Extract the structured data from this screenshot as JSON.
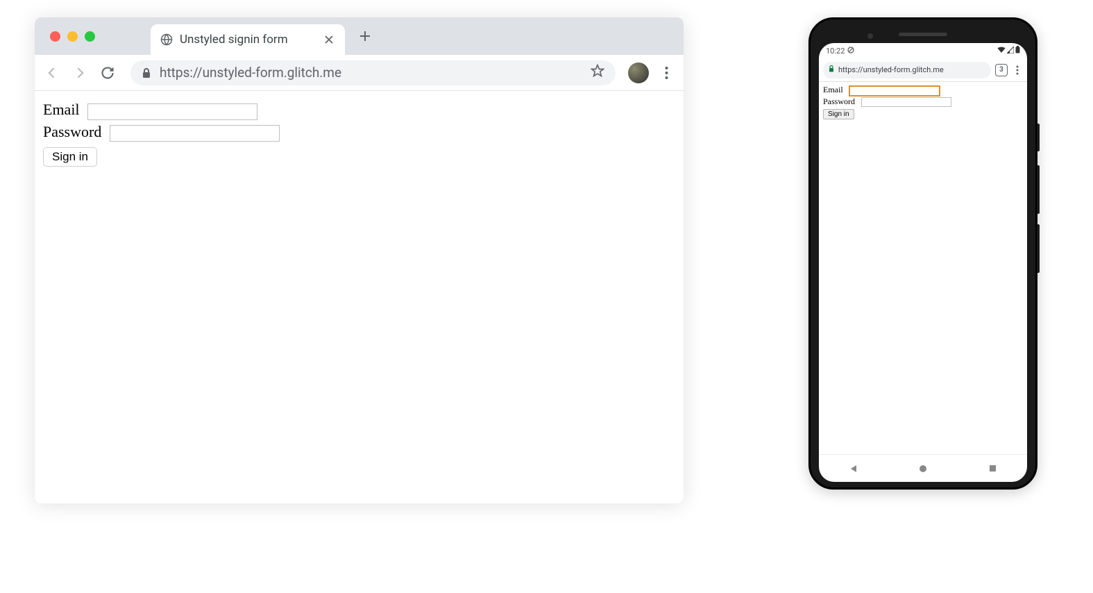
{
  "desktop": {
    "tab": {
      "title": "Unstyled signin form"
    },
    "url": "https://unstyled-form.glitch.me",
    "form": {
      "email_label": "Email",
      "password_label": "Password",
      "signin_label": "Sign in"
    }
  },
  "mobile": {
    "status": {
      "time": "10:22"
    },
    "url": "https://unstyled-form.glitch.me",
    "tab_count": "3",
    "form": {
      "email_label": "Email",
      "password_label": "Password",
      "signin_label": "Sign in"
    }
  }
}
